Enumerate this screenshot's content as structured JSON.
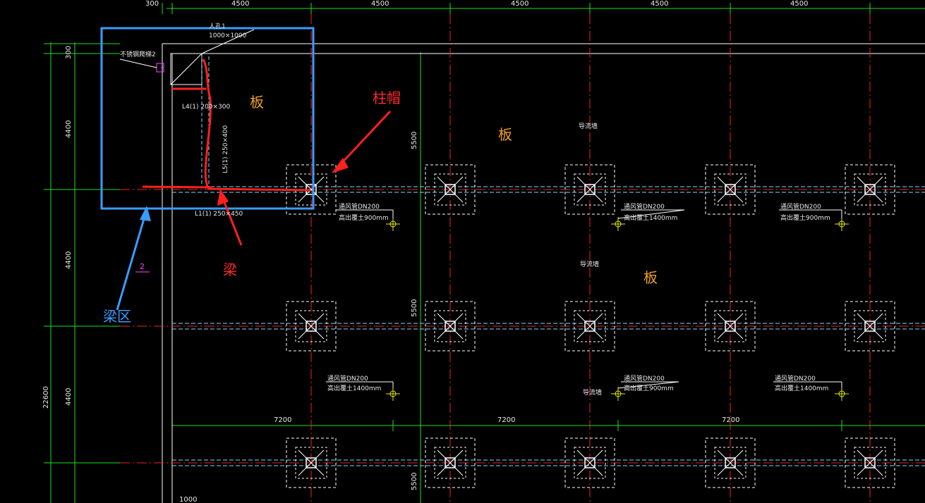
{
  "drawing": {
    "top_dims": [
      "300",
      "4500",
      "4500",
      "4500",
      "4500",
      "4500"
    ],
    "left_dims": [
      "300",
      "4400",
      "4400",
      "4400"
    ],
    "total_height_dim": "22600",
    "span_dims": [
      "7200",
      "7200",
      "7200"
    ],
    "vertical_5500": [
      "5500",
      "5500",
      "5500"
    ],
    "bottom_dim": "1000"
  },
  "labels": {
    "board": "板",
    "column_cap": "柱帽",
    "beam": "梁",
    "beam_zone": "梁区"
  },
  "corner": {
    "manhole": "人孔1",
    "manhole_size": "1000×1000",
    "ladder": "不锈钢爬梯2",
    "beam_l4": "L4(1) 200×300",
    "beam_l5": "L5(1) 250×400",
    "beam_l1": "L1(1) 250×450"
  },
  "mark_2": "2",
  "pipes": [
    {
      "line1": "通风管DN200",
      "line2": "高出覆土900mm"
    },
    {
      "line1": "通风管DN200",
      "line2": "高出覆土1400mm"
    },
    {
      "line1": "通风管DN200",
      "line2": "高出覆土900mm"
    },
    {
      "line1": "通风管DN200",
      "line2": "高出覆土1400mm"
    },
    {
      "line1": "通风管DN200",
      "line2": "高出覆土900mm"
    },
    {
      "line1": "通风管DN200",
      "line2": "高出覆土1400mm"
    }
  ],
  "guide_walls": [
    "导流墙",
    "导流墙",
    "导流墙"
  ],
  "colors": {
    "background": "#000000",
    "dimension_green": "#22dd22",
    "axis_red": "#ee2222",
    "outline_white": "#ffffff",
    "beam_cyan": "#7fd8ff",
    "highlight_blue": "#3a9cff",
    "board_orange": "#f0a020",
    "pipe_yellow": "#e8e800"
  }
}
